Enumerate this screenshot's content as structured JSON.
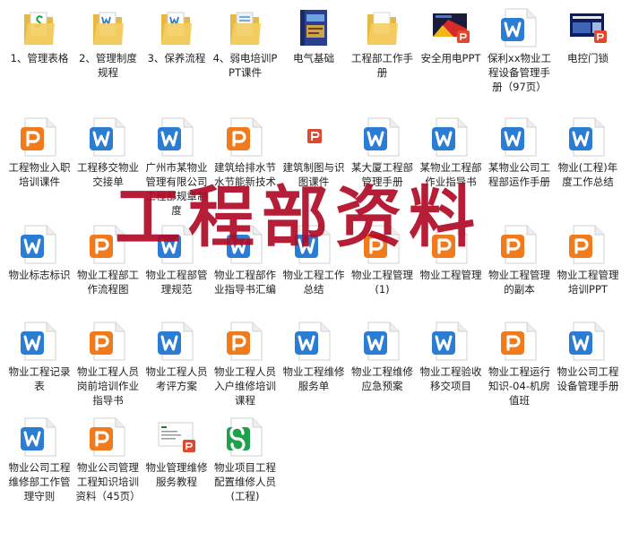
{
  "watermark": "工程部资料",
  "colors": {
    "word": "#2b7cd3",
    "ppt": "#f07b1d",
    "excel": "#1fa04c",
    "folder": "#f5cd62",
    "folder_dark": "#e6b845",
    "pdf_badge": "#e0492f",
    "watermark": "#b00a26"
  },
  "files": [
    {
      "label": "1、管理表格",
      "type": "folder-excel",
      "icon": "folder-icon"
    },
    {
      "label": "2、管理制度规程",
      "type": "folder-word",
      "icon": "folder-icon"
    },
    {
      "label": "3、保养流程",
      "type": "folder-word",
      "icon": "folder-icon"
    },
    {
      "label": "4、弱电培训PPT课件",
      "type": "folder-doc",
      "icon": "folder-icon"
    },
    {
      "label": "电气基础",
      "type": "book",
      "icon": "book-thumbnail-icon"
    },
    {
      "label": "工程部工作手册",
      "type": "folder",
      "icon": "folder-icon"
    },
    {
      "label": "安全用电PPT",
      "type": "thumb-ppt",
      "icon": "slide-thumbnail-icon"
    },
    {
      "label": "保利xx物业工程设备管理手册（97页）",
      "type": "word",
      "icon": "word-document-icon"
    },
    {
      "label": "电控门锁",
      "type": "thumb-ppt-blue",
      "icon": "slide-thumbnail-icon"
    },
    {
      "label": "工程物业入职培训课件",
      "type": "ppt",
      "icon": "ppt-document-icon"
    },
    {
      "label": "工程移交物业交接单",
      "type": "word",
      "icon": "word-document-icon"
    },
    {
      "label": "广州市某物业管理有限公司工程部规章制度",
      "type": "word",
      "icon": "word-document-icon"
    },
    {
      "label": "建筑给排水节水节能新技术",
      "type": "ppt",
      "icon": "ppt-document-icon"
    },
    {
      "label": "建筑制图与识图课件",
      "type": "ppt-small",
      "icon": "ppt-badge-icon"
    },
    {
      "label": "某大厦工程部管理手册",
      "type": "word",
      "icon": "word-document-icon"
    },
    {
      "label": "某物业工程部作业指导书",
      "type": "word",
      "icon": "word-document-icon"
    },
    {
      "label": "某物业公司工程部运作手册",
      "type": "word",
      "icon": "word-document-icon"
    },
    {
      "label": "物业(工程)年度工作总结",
      "type": "word",
      "icon": "word-document-icon"
    },
    {
      "label": "物业标志标识",
      "type": "word",
      "icon": "word-document-icon"
    },
    {
      "label": "物业工程部工作流程图",
      "type": "ppt",
      "icon": "ppt-document-icon"
    },
    {
      "label": "物业工程部管理规范",
      "type": "word",
      "icon": "word-document-icon"
    },
    {
      "label": "物业工程部作业指导书汇编",
      "type": "word",
      "icon": "word-document-icon"
    },
    {
      "label": "物业工程工作总结",
      "type": "word",
      "icon": "word-document-icon"
    },
    {
      "label": "物业工程管理 (1)",
      "type": "ppt",
      "icon": "ppt-document-icon"
    },
    {
      "label": "物业工程管理",
      "type": "ppt",
      "icon": "ppt-document-icon"
    },
    {
      "label": "物业工程管理的副本",
      "type": "ppt",
      "icon": "ppt-document-icon"
    },
    {
      "label": "物业工程管理培训PPT",
      "type": "ppt",
      "icon": "ppt-document-icon"
    },
    {
      "label": "物业工程记录表",
      "type": "word",
      "icon": "word-document-icon"
    },
    {
      "label": "物业工程人员岗前培训作业指导书",
      "type": "ppt",
      "icon": "ppt-document-icon"
    },
    {
      "label": "物业工程人员考评方案",
      "type": "word",
      "icon": "word-document-icon"
    },
    {
      "label": "物业工程人员入户维修培训课程",
      "type": "ppt",
      "icon": "ppt-document-icon"
    },
    {
      "label": "物业工程维修服务单",
      "type": "word",
      "icon": "word-document-icon"
    },
    {
      "label": "物业工程维修应急预案",
      "type": "word",
      "icon": "word-document-icon"
    },
    {
      "label": "物业工程验收移交项目",
      "type": "word",
      "icon": "word-document-icon"
    },
    {
      "label": "物业工程运行知识-04-机房值班",
      "type": "ppt",
      "icon": "ppt-document-icon"
    },
    {
      "label": "物业公司工程设备管理手册",
      "type": "word",
      "icon": "word-document-icon"
    },
    {
      "label": "物业公司工程维修部工作管理守则",
      "type": "word",
      "icon": "word-document-icon"
    },
    {
      "label": "物业公司管理工程知识培训资料（45页）",
      "type": "ppt",
      "icon": "ppt-document-icon"
    },
    {
      "label": "物业管理维修服务教程",
      "type": "thumb-doc",
      "icon": "slide-thumbnail-icon"
    },
    {
      "label": "物业项目工程配置维修人员(工程)",
      "type": "excel",
      "icon": "excel-document-icon"
    }
  ]
}
